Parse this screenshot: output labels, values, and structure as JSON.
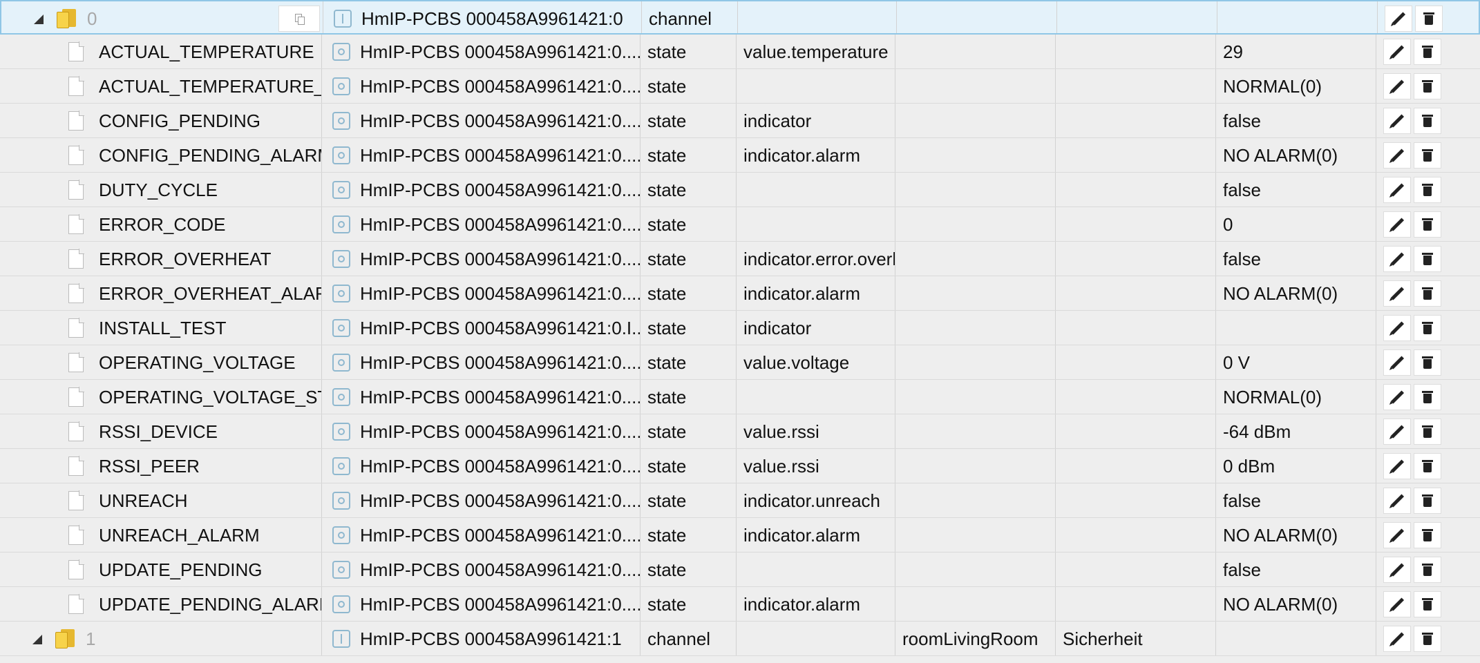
{
  "rows": [
    {
      "kind": "channel",
      "selected": true,
      "name": "0",
      "desc": "HmIP-PCBS 000458A9961421:0",
      "type": "channel",
      "role": "",
      "room": "",
      "function": "",
      "value": "",
      "has_copy": true
    },
    {
      "kind": "state",
      "name": "ACTUAL_TEMPERATURE",
      "desc": "HmIP-PCBS 000458A9961421:0....",
      "type": "state",
      "role": "value.temperature",
      "room": "",
      "function": "",
      "value": "29"
    },
    {
      "kind": "state",
      "name": "ACTUAL_TEMPERATURE_ST.",
      "desc": "HmIP-PCBS 000458A9961421:0....",
      "type": "state",
      "role": "",
      "room": "",
      "function": "",
      "value": "NORMAL(0)"
    },
    {
      "kind": "state",
      "name": "CONFIG_PENDING",
      "desc": "HmIP-PCBS 000458A9961421:0....",
      "type": "state",
      "role": "indicator",
      "room": "",
      "function": "",
      "value": "false"
    },
    {
      "kind": "state",
      "name": "CONFIG_PENDING_ALARM",
      "desc": "HmIP-PCBS 000458A9961421:0....",
      "type": "state",
      "role": "indicator.alarm",
      "room": "",
      "function": "",
      "value": "NO ALARM(0)"
    },
    {
      "kind": "state",
      "name": "DUTY_CYCLE",
      "desc": "HmIP-PCBS 000458A9961421:0....",
      "type": "state",
      "role": "",
      "room": "",
      "function": "",
      "value": "false"
    },
    {
      "kind": "state",
      "name": "ERROR_CODE",
      "desc": "HmIP-PCBS 000458A9961421:0....",
      "type": "state",
      "role": "",
      "room": "",
      "function": "",
      "value": "0"
    },
    {
      "kind": "state",
      "name": "ERROR_OVERHEAT",
      "desc": "HmIP-PCBS 000458A9961421:0....",
      "type": "state",
      "role": "indicator.error.overh",
      "room": "",
      "function": "",
      "value": "false"
    },
    {
      "kind": "state",
      "name": "ERROR_OVERHEAT_ALARM",
      "desc": "HmIP-PCBS 000458A9961421:0....",
      "type": "state",
      "role": "indicator.alarm",
      "room": "",
      "function": "",
      "value": "NO ALARM(0)"
    },
    {
      "kind": "state",
      "name": "INSTALL_TEST",
      "desc": "HmIP-PCBS 000458A9961421:0.I...",
      "type": "state",
      "role": "indicator",
      "room": "",
      "function": "",
      "value": ""
    },
    {
      "kind": "state",
      "name": "OPERATING_VOLTAGE",
      "desc": "HmIP-PCBS 000458A9961421:0....",
      "type": "state",
      "role": "value.voltage",
      "room": "",
      "function": "",
      "value": "0 V"
    },
    {
      "kind": "state",
      "name": "OPERATING_VOLTAGE_STAT",
      "desc": "HmIP-PCBS 000458A9961421:0....",
      "type": "state",
      "role": "",
      "room": "",
      "function": "",
      "value": "NORMAL(0)"
    },
    {
      "kind": "state",
      "name": "RSSI_DEVICE",
      "desc": "HmIP-PCBS 000458A9961421:0....",
      "type": "state",
      "role": "value.rssi",
      "room": "",
      "function": "",
      "value": "-64 dBm"
    },
    {
      "kind": "state",
      "name": "RSSI_PEER",
      "desc": "HmIP-PCBS 000458A9961421:0....",
      "type": "state",
      "role": "value.rssi",
      "room": "",
      "function": "",
      "value": "0 dBm"
    },
    {
      "kind": "state",
      "name": "UNREACH",
      "desc": "HmIP-PCBS 000458A9961421:0....",
      "type": "state",
      "role": "indicator.unreach",
      "room": "",
      "function": "",
      "value": "false"
    },
    {
      "kind": "state",
      "name": "UNREACH_ALARM",
      "desc": "HmIP-PCBS 000458A9961421:0....",
      "type": "state",
      "role": "indicator.alarm",
      "room": "",
      "function": "",
      "value": "NO ALARM(0)"
    },
    {
      "kind": "state",
      "name": "UPDATE_PENDING",
      "desc": "HmIP-PCBS 000458A9961421:0....",
      "type": "state",
      "role": "",
      "room": "",
      "function": "",
      "value": "false"
    },
    {
      "kind": "state",
      "name": "UPDATE_PENDING_ALARM",
      "desc": "HmIP-PCBS 000458A9961421:0....",
      "type": "state",
      "role": "indicator.alarm",
      "room": "",
      "function": "",
      "value": "NO ALARM(0)"
    },
    {
      "kind": "channel",
      "selected": false,
      "name": "1",
      "desc": "HmIP-PCBS 000458A9961421:1",
      "type": "channel",
      "role": "",
      "room": "roomLivingRoom",
      "function": "Sicherheit",
      "value": "",
      "has_copy": false
    }
  ],
  "icons": {
    "state_file": "file-icon",
    "channel_folder": "folder-icon",
    "expand": "chevron-down-icon",
    "copy": "copy-icon",
    "edit": "pencil-icon",
    "delete": "trash-icon"
  },
  "colors": {
    "row_bg": "#eeeeee",
    "selected_bg": "#e4f2fa",
    "selected_border": "#8fc6e6",
    "folder": "#f7d34a"
  }
}
